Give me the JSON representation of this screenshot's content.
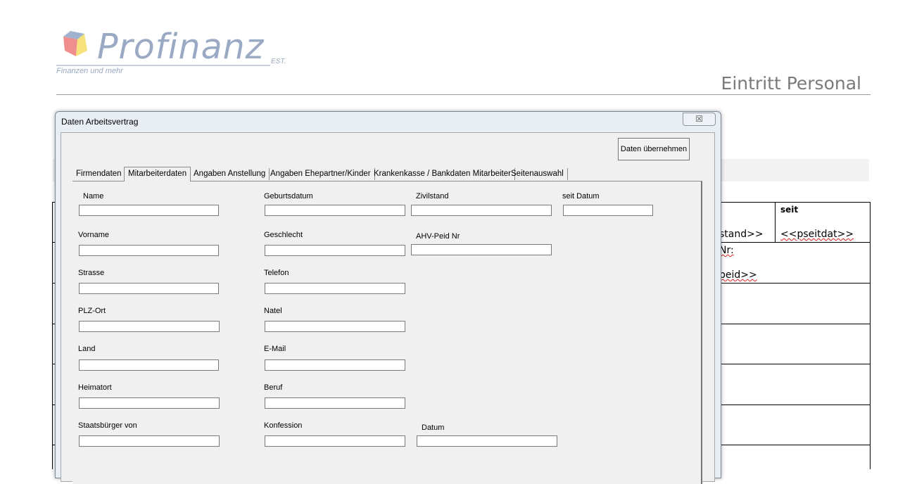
{
  "logo": {
    "name": "Profinanz",
    "est": "EST.",
    "tagline": "Finanzen und mehr"
  },
  "document": {
    "title": "Eintritt Personal",
    "cells": {
      "seit_header": "seit",
      "zivilstand_field": "stand>>",
      "seitdat_field": "<<pseitdat>>",
      "nr_label": "Nr:",
      "peid_field": "peid>>"
    }
  },
  "dialog": {
    "title": "Daten Arbeitsvertrag",
    "close_label": "☒",
    "apply_label": "Daten übernehmen",
    "tabs": [
      {
        "label": "Firmendaten"
      },
      {
        "label": "Mitarbeiterdaten"
      },
      {
        "label": "Angaben Anstellung"
      },
      {
        "label": "Angaben Ehepartner/Kinder"
      },
      {
        "label": "Krankenkasse / Bankdaten Mitarbeiter"
      },
      {
        "label": "Seitenauswahl"
      }
    ],
    "active_tab": "Mitarbeiterdaten",
    "fields": {
      "name": {
        "label": "Name",
        "value": ""
      },
      "vorname": {
        "label": "Vorname",
        "value": ""
      },
      "strasse": {
        "label": "Strasse",
        "value": ""
      },
      "plz_ort": {
        "label": "PLZ-Ort",
        "value": ""
      },
      "land": {
        "label": "Land",
        "value": ""
      },
      "heimatort": {
        "label": "Heimatort",
        "value": ""
      },
      "staatsbuerger": {
        "label": "Staatsbürger von",
        "value": ""
      },
      "geburtsdatum": {
        "label": "Geburtsdatum",
        "value": ""
      },
      "geschlecht": {
        "label": "Geschlecht",
        "value": ""
      },
      "telefon": {
        "label": "Telefon",
        "value": ""
      },
      "natel": {
        "label": "Natel",
        "value": ""
      },
      "email": {
        "label": "E-Mail",
        "value": ""
      },
      "beruf": {
        "label": "Beruf",
        "value": ""
      },
      "konfession": {
        "label": "Konfession",
        "value": ""
      },
      "zivilstand": {
        "label": "Zivilstand",
        "value": ""
      },
      "ahv": {
        "label": "AHV-Peid Nr",
        "value": ""
      },
      "datum": {
        "label": "Datum",
        "value": ""
      },
      "seit_datum": {
        "label": "seit Datum",
        "value": ""
      }
    }
  }
}
